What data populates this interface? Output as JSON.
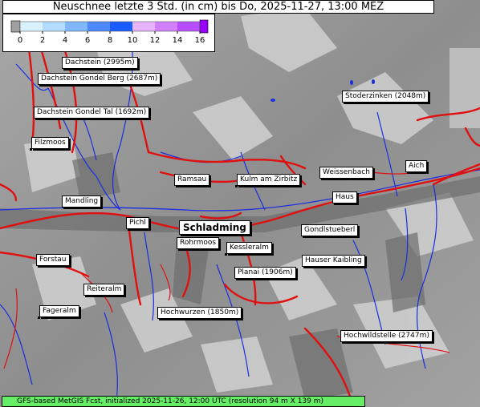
{
  "title": "Neuschnee letzte 3 Std. (in cm) bis Do, 2025-11-27, 13:00 MEZ",
  "legend": {
    "ticks": [
      "0",
      "2",
      "4",
      "6",
      "8",
      "10",
      "12",
      "14",
      "16"
    ],
    "colors": [
      "#a0a0a0",
      "#d9f0ff",
      "#b3dcff",
      "#80b8ff",
      "#4d88ff",
      "#1a5cff",
      "#e6b3ff",
      "#d080ff",
      "#b84dff",
      "#9900ff"
    ]
  },
  "places": [
    {
      "name": "Dachstein (2995m)",
      "dot": "br"
    },
    {
      "name": "Dachstein Gondel Berg (2687m)",
      "dot": "br"
    },
    {
      "name": "Dachstein Gondel Tal (1692m)",
      "dot": "br"
    },
    {
      "name": "Stoderzinken (2048m)",
      "dot": "br"
    },
    {
      "name": "Filzmoos",
      "dot": "bl"
    },
    {
      "name": "Weissenbach",
      "dot": "br"
    },
    {
      "name": "Aich",
      "dot": "br"
    },
    {
      "name": "Ramsau",
      "dot": "br"
    },
    {
      "name": "Kulm am Zirbitz",
      "dot": "bl"
    },
    {
      "name": "Mandling",
      "dot": "br"
    },
    {
      "name": "Haus",
      "dot": "br"
    },
    {
      "name": "Pichl",
      "dot": "br"
    },
    {
      "name": "Schladming",
      "dot": "br"
    },
    {
      "name": "Gondlstueberl",
      "dot": "br"
    },
    {
      "name": "Rohrmoos",
      "dot": "br"
    },
    {
      "name": "Kessleralm",
      "dot": "bl"
    },
    {
      "name": "Forstau",
      "dot": "br"
    },
    {
      "name": "Hauser Kaibling",
      "dot": "br"
    },
    {
      "name": "Planai (1906m)",
      "dot": "br"
    },
    {
      "name": "Reiteralm",
      "dot": "br"
    },
    {
      "name": "Fageralm",
      "dot": "bl"
    },
    {
      "name": "Hochwurzen (1850m)",
      "dot": "br"
    },
    {
      "name": "Hochwildstelle (2747m)",
      "dot": "br"
    }
  ],
  "footer": "GFS-based MetGIS Fcst, initialized 2025-11-26, 12:00 UTC  (resolution 94 m X 139 m)"
}
